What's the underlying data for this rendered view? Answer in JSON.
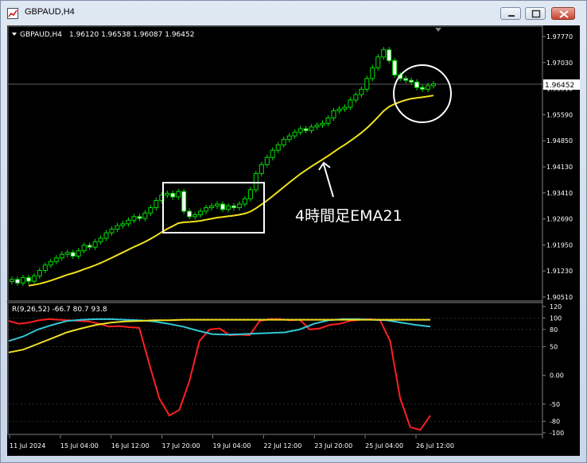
{
  "window": {
    "title": "GBPAUD,H4"
  },
  "chart_header": {
    "symbol": "GBPAUD,H4",
    "ohlc": "1.96120 1.96538 1.96087 1.96452"
  },
  "price_axis": {
    "ticks": [
      "1.97770",
      "1.97030",
      "1.96310",
      "1.95590",
      "1.94850",
      "1.94130",
      "1.93410",
      "1.92690",
      "1.91950",
      "1.91230",
      "1.90510"
    ],
    "current_price": "1.96452"
  },
  "indicator": {
    "header": "R(9,26,52) -66.7 80.7 93.8",
    "ticks": [
      "120",
      "100",
      "80",
      "50",
      "0.00",
      "-50",
      "-80",
      "-100"
    ]
  },
  "time_axis": {
    "labels": [
      "11 Jul 2024",
      "15 Jul 04:00",
      "16 Jul 12:00",
      "17 Jul 20:00",
      "19 Jul 04:00",
      "22 Jul 12:00",
      "23 Jul 20:00",
      "25 Jul 04:00",
      "26 Jul 12:00"
    ]
  },
  "annotation": {
    "label": "4時間足EMA21"
  },
  "chart_data": {
    "type": "candlestick",
    "price_range": [
      1.9051,
      1.9777
    ],
    "candles_close": [
      1.91,
      1.909,
      1.9105,
      1.9095,
      1.911,
      1.9125,
      1.914,
      1.915,
      1.916,
      1.917,
      1.9175,
      1.9165,
      1.918,
      1.9195,
      1.919,
      1.9205,
      1.9215,
      1.923,
      1.924,
      1.925,
      1.9255,
      1.9265,
      1.9275,
      1.927,
      1.9285,
      1.93,
      1.932,
      1.9335,
      1.934,
      1.933,
      1.9345,
      1.929,
      1.9275,
      1.928,
      1.929,
      1.93,
      1.9305,
      1.931,
      1.9295,
      1.9305,
      1.93,
      1.931,
      1.9325,
      1.935,
      1.9395,
      1.942,
      1.944,
      1.946,
      1.9475,
      1.949,
      1.95,
      1.951,
      1.952,
      1.9515,
      1.9525,
      1.953,
      1.9535,
      1.955,
      1.957,
      1.9575,
      1.958,
      1.96,
      1.9615,
      1.963,
      1.966,
      1.969,
      1.972,
      1.974,
      1.971,
      1.967,
      1.966,
      1.9655,
      1.965,
      1.9635,
      1.963,
      1.964,
      1.9645
    ],
    "ema21_series_name": "4時間足EMA21",
    "indicator_series": [
      {
        "color": "#ff2020",
        "values": [
          95,
          90,
          92,
          96,
          98,
          97,
          96,
          95,
          94,
          90,
          85,
          86,
          84,
          83,
          20,
          -40,
          -70,
          -60,
          -10,
          60,
          80,
          82,
          70,
          71,
          70,
          95,
          98,
          98,
          96,
          97,
          80,
          82,
          88,
          90,
          95,
          97,
          98,
          96,
          60,
          -40,
          -90,
          -95,
          -70
        ]
      },
      {
        "color": "#30c8d8",
        "values": [
          60,
          68,
          80,
          88,
          95,
          97,
          98,
          98,
          97,
          96,
          94,
          90,
          85,
          78,
          72,
          71,
          72,
          73,
          74,
          75,
          80,
          90,
          96,
          98,
          98,
          97,
          96,
          92,
          88,
          85
        ]
      },
      {
        "color": "#f0e020",
        "values": [
          40,
          45,
          55,
          65,
          75,
          82,
          88,
          92,
          94,
          95,
          96,
          96,
          97,
          97,
          97,
          97,
          97,
          97,
          97,
          97,
          97,
          97,
          97,
          97,
          97,
          97,
          97,
          97,
          97,
          97
        ]
      }
    ]
  }
}
